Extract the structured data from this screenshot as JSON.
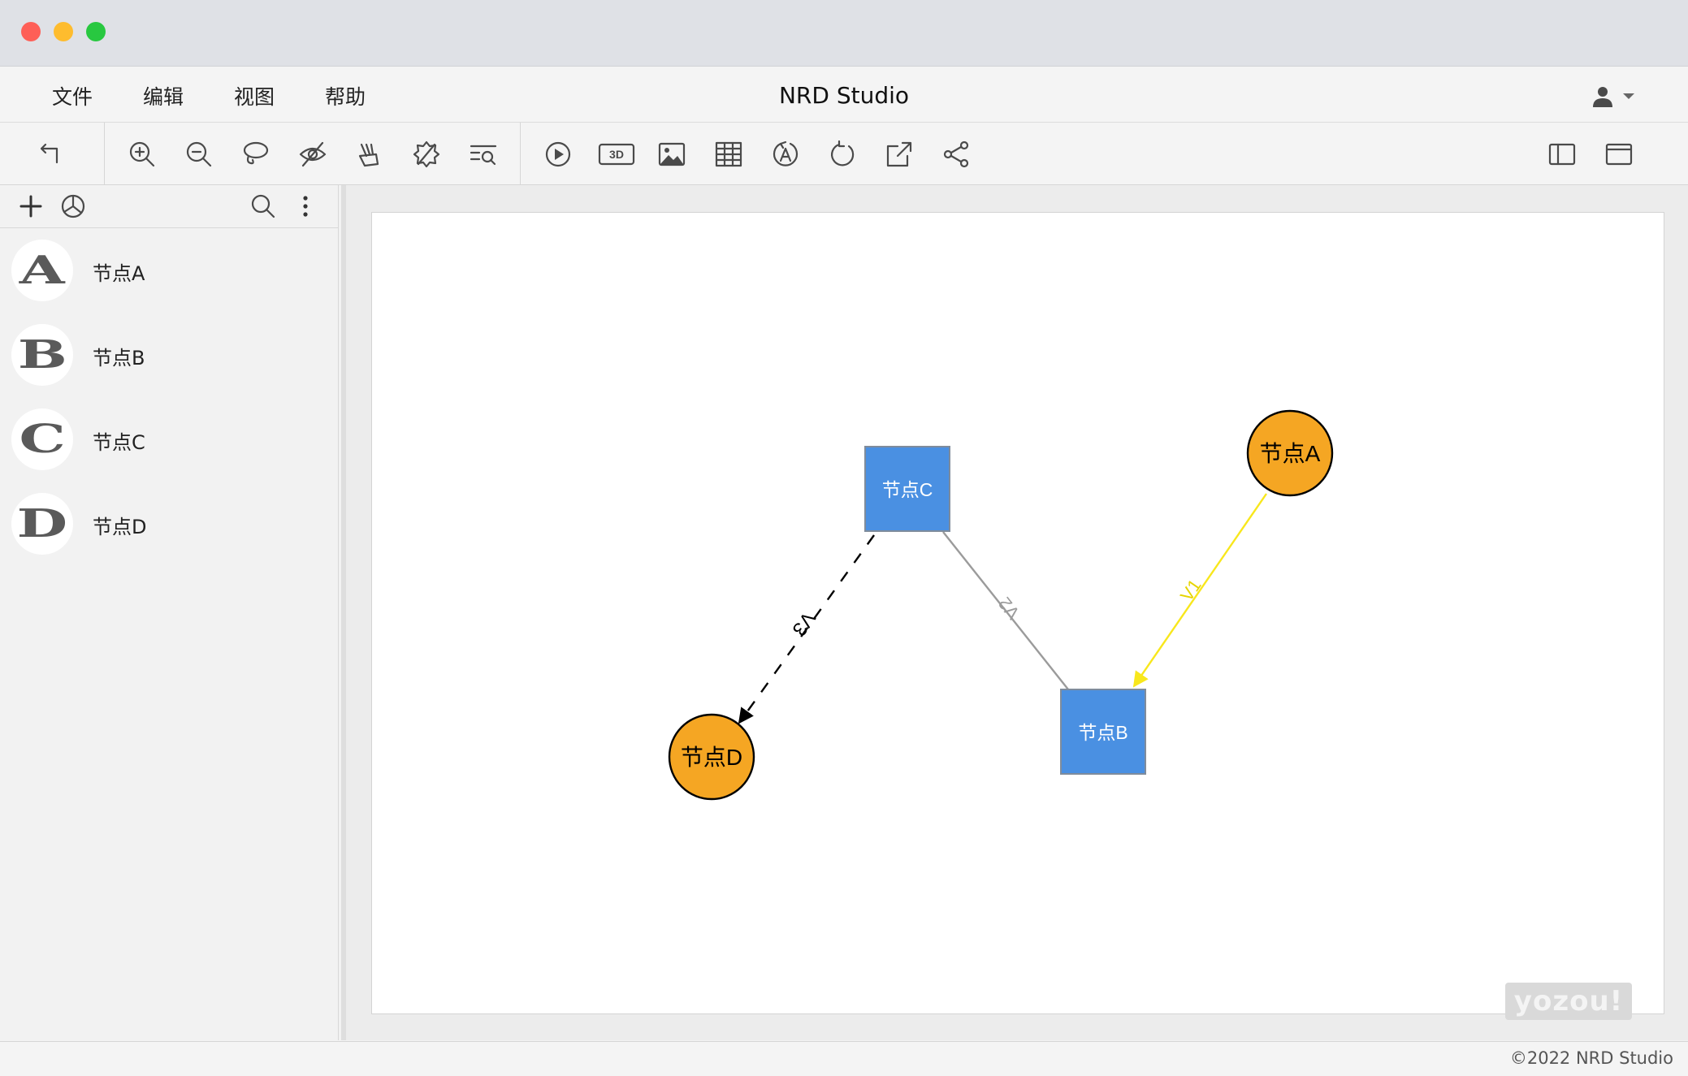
{
  "window": {
    "app_title": "NRD Studio"
  },
  "menu": {
    "items": [
      {
        "label": "文件"
      },
      {
        "label": "编辑"
      },
      {
        "label": "视图"
      },
      {
        "label": "帮助"
      }
    ]
  },
  "toolbar": {
    "icons": [
      "undo-icon",
      "zoom-in-icon",
      "zoom-out-icon",
      "lasso-icon",
      "hide-icon",
      "brush-icon",
      "clear-selection-icon",
      "search-list-icon",
      "play-icon",
      "3d-icon",
      "image-icon",
      "table-icon",
      "auto-layout-icon",
      "refresh-icon",
      "export-icon",
      "share-icon",
      "sidebar-toggle-icon",
      "window-icon"
    ],
    "three_d_label": "3D"
  },
  "left_panel": {
    "nodes": [
      {
        "letter": "A",
        "label": "节点A"
      },
      {
        "letter": "B",
        "label": "节点B"
      },
      {
        "letter": "C",
        "label": "节点C"
      },
      {
        "letter": "D",
        "label": "节点D"
      }
    ]
  },
  "graph": {
    "nodes": [
      {
        "label": "节点A",
        "shape": "circle",
        "color": "#F5A623"
      },
      {
        "label": "节点B",
        "shape": "square",
        "color": "#4A90E2"
      },
      {
        "label": "节点C",
        "shape": "square",
        "color": "#4A90E2"
      },
      {
        "label": "节点D",
        "shape": "circle",
        "color": "#F5A623"
      }
    ],
    "edges": [
      {
        "label": "V1",
        "from": "节点A",
        "to": "节点B",
        "color": "#F8E71C",
        "style": "solid"
      },
      {
        "label": "V2",
        "from": "节点C",
        "to": "节点B",
        "color": "#9B9B9B",
        "style": "solid"
      },
      {
        "label": "V3",
        "from": "节点C",
        "to": "节点D",
        "color": "#000000",
        "style": "dashed"
      }
    ]
  },
  "watermark": "yozou!",
  "status": {
    "copyright": "©2022 NRD Studio"
  }
}
